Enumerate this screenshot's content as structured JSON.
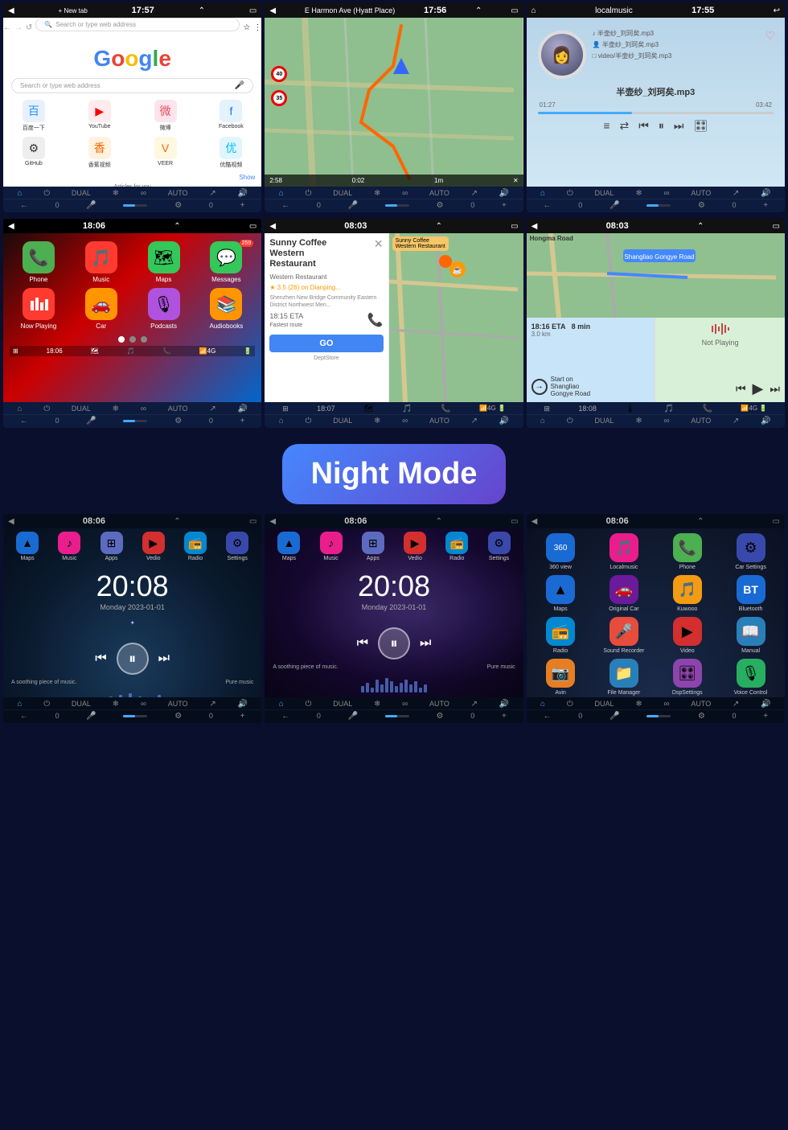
{
  "page": {
    "background": "#0a0f2e"
  },
  "sections": [
    {
      "id": "top-row",
      "screens": [
        {
          "id": "chrome",
          "time": "17:57",
          "title": "New tab",
          "type": "browser",
          "google_text": "Google",
          "search_placeholder": "Search or type web address",
          "quick_links": [
            {
              "label": "百度一下",
              "color": "#2196F3",
              "icon": "🔵"
            },
            {
              "label": "YouTube",
              "color": "#FF0000",
              "icon": "▶"
            },
            {
              "label": "微博",
              "color": "#E84B5A",
              "icon": "微"
            },
            {
              "label": "Facebook",
              "color": "#1877F2",
              "icon": "f"
            },
            {
              "label": "GitHub",
              "color": "#333",
              "icon": "⬤"
            },
            {
              "label": "香蕉视频",
              "color": "#FFD700",
              "icon": "🍌"
            },
            {
              "label": "VEER",
              "color": "#FF6600",
              "icon": "V"
            },
            {
              "label": "优酷视频",
              "color": "#00BFFF",
              "icon": "✦"
            }
          ],
          "footer": {
            "left": "🏠",
            "items": [
              "DUAL",
              "❄",
              "∞",
              "AUTO",
              "↗",
              "🔊"
            ]
          }
        },
        {
          "id": "gps-map",
          "time": "17:56",
          "title": "E Harmon Ave (Hyatt Place)",
          "type": "map",
          "eta": "2:58",
          "distance": "0:02",
          "scale": "1m",
          "speed1": "40",
          "speed2": "35"
        },
        {
          "id": "music",
          "time": "17:55",
          "title": "localmusic",
          "type": "music",
          "track": "半壶纱_刘珂矣.mp3",
          "track2": "半壶纱_刘珂矣.mp3",
          "track3": "video/半壶纱_刘珂矣.mp3",
          "display_track": "半壶纱_刘珂矣.mp3",
          "time_current": "01:27",
          "time_total": "03:42",
          "progress": 40
        }
      ]
    },
    {
      "id": "middle-row",
      "screens": [
        {
          "id": "carplay-home",
          "time": "18:06",
          "type": "carplay",
          "apps": [
            {
              "label": "Phone",
              "color": "#4CAF50",
              "icon": "📞"
            },
            {
              "label": "Music",
              "color": "#FF3B30",
              "icon": "🎵"
            },
            {
              "label": "Maps",
              "color": "#34C759",
              "icon": "🗺"
            },
            {
              "label": "Messages",
              "color": "#34C759",
              "icon": "💬"
            },
            {
              "label": "Now Playing",
              "color": "#FF3B30",
              "icon": "▶"
            },
            {
              "label": "Car",
              "color": "#FF9500",
              "icon": "🚗"
            },
            {
              "label": "Podcasts",
              "color": "#AF52DE",
              "icon": "🎙"
            },
            {
              "label": "Audiobooks",
              "color": "#FF9500",
              "icon": "📚"
            }
          ],
          "status": "18:06",
          "badge": "259"
        },
        {
          "id": "carplay-nav",
          "time": "08:03",
          "type": "carplay-nav",
          "restaurant": "Sunny Coffee Western Restaurant",
          "category": "Western Restaurant",
          "rating": "3.5 (26) on Dianping...",
          "address": "Shenzhen New Bridge Community Eastern District Northwest Men...",
          "eta": "18:15 ETA",
          "route": "Fastest route",
          "button": "GO",
          "time_display": "18:07"
        },
        {
          "id": "carplay-split",
          "time": "08:03",
          "type": "carplay-split",
          "road": "Hongma Road",
          "destination": "Shangliao Gongye Road",
          "eta": "18:16 ETA",
          "duration": "8 min",
          "distance": "3.0 km",
          "nav_label": "Start on Shangliao Gongye Road",
          "media": "Not Playing",
          "time_display": "18:08"
        }
      ]
    },
    {
      "id": "night-mode-label",
      "text": "Night Mode"
    },
    {
      "id": "bottom-row",
      "screens": [
        {
          "id": "night-home-1",
          "time": "08:06",
          "type": "night-home",
          "apps": [
            {
              "label": "Maps",
              "color": "#4af",
              "icon": "▲"
            },
            {
              "label": "Music",
              "color": "#ff6b9d",
              "icon": "♪"
            },
            {
              "label": "Apps",
              "color": "#7c8cf8",
              "icon": "⊞"
            },
            {
              "label": "Vedio",
              "color": "#ff4444",
              "icon": "▶"
            },
            {
              "label": "Radio",
              "color": "#4fc3f7",
              "icon": "📻"
            },
            {
              "label": "Settings",
              "color": "#7c8cf8",
              "icon": "⚙"
            }
          ],
          "clock": "20:08",
          "date": "Monday  2023-01-01",
          "music_label1": "A soothing piece of music.",
          "music_label2": "Pure music"
        },
        {
          "id": "night-home-2",
          "time": "08:06",
          "type": "night-home",
          "apps": [
            {
              "label": "Maps",
              "color": "#4af",
              "icon": "▲"
            },
            {
              "label": "Music",
              "color": "#ff6b9d",
              "icon": "♪"
            },
            {
              "label": "Apps",
              "color": "#7c8cf8",
              "icon": "⊞"
            },
            {
              "label": "Vedio",
              "color": "#ff4444",
              "icon": "▶"
            },
            {
              "label": "Radio",
              "color": "#4fc3f7",
              "icon": "📻"
            },
            {
              "label": "Settings",
              "color": "#7c8cf8",
              "icon": "⚙"
            }
          ],
          "clock": "20:08",
          "date": "Monday  2023-01-01",
          "music_label1": "A soothing piece of music.",
          "music_label2": "Pure music",
          "bg_variant": "galaxy"
        },
        {
          "id": "night-apps",
          "time": "08:06",
          "type": "night-apps",
          "apps": [
            {
              "label": "360 view",
              "color": "#4af",
              "icon": "🔵"
            },
            {
              "label": "Localmusic",
              "color": "#ff6b9d",
              "icon": "🎵"
            },
            {
              "label": "Phone",
              "color": "#4CAF50",
              "icon": "📞"
            },
            {
              "label": "Car Settings",
              "color": "#7c8cf8",
              "icon": "⚙"
            },
            {
              "label": "Maps",
              "color": "#4af",
              "icon": "▲"
            },
            {
              "label": "Original Car",
              "color": "#9b59b6",
              "icon": "🚗"
            },
            {
              "label": "Kuwooo",
              "color": "#f39c12",
              "icon": "🎵"
            },
            {
              "label": "Bluetooth",
              "color": "#4af",
              "icon": "⚡"
            },
            {
              "label": "Radio",
              "color": "#4fc3f7",
              "icon": "📻"
            },
            {
              "label": "Sound Recorder",
              "color": "#e74c3c",
              "icon": "🎤"
            },
            {
              "label": "Video",
              "color": "#e74c3c",
              "icon": "▶"
            },
            {
              "label": "Manual",
              "color": "#3498db",
              "icon": "📖"
            },
            {
              "label": "Avin",
              "color": "#e67e22",
              "icon": "📷"
            },
            {
              "label": "File Manager",
              "color": "#3498db",
              "icon": "📁"
            },
            {
              "label": "DspSettings",
              "color": "#9b59b6",
              "icon": "🎛"
            },
            {
              "label": "Voice Control",
              "color": "#27ae60",
              "icon": "🎙"
            }
          ]
        }
      ]
    }
  ]
}
